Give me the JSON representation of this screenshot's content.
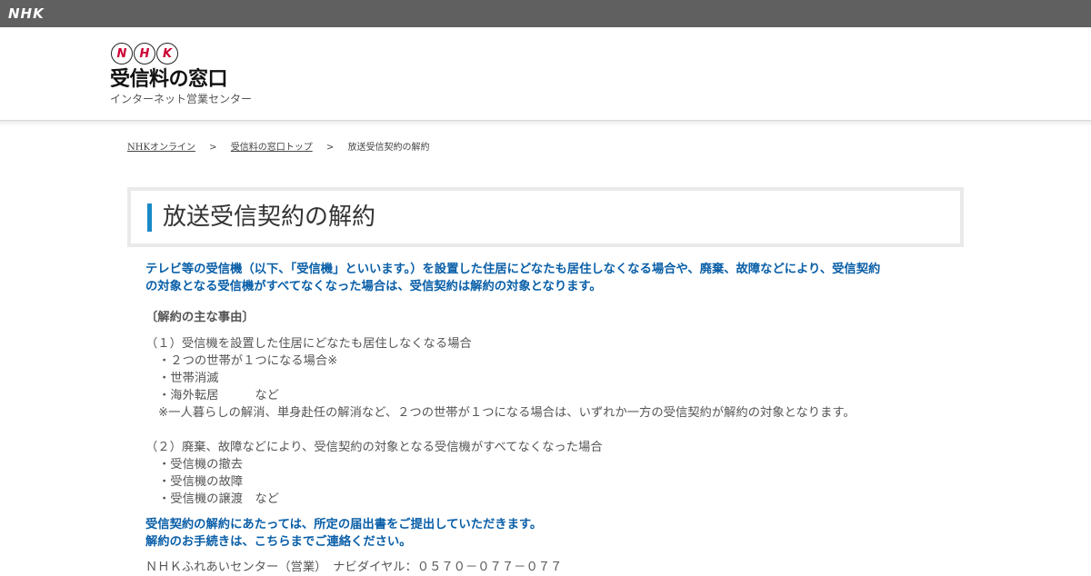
{
  "topbar": {
    "brand": "NHK"
  },
  "header": {
    "logo_letters": [
      "N",
      "H",
      "K"
    ],
    "logo_title": "受信料の窓口",
    "logo_subtitle": "インターネット営業センター"
  },
  "breadcrumb": {
    "items": [
      "NHKオンライン",
      "受信料の窓口トップ",
      "放送受信契約の解約"
    ],
    "separator": ">"
  },
  "page": {
    "title": "放送受信契約の解約",
    "intro_line1": "テレビ等の受信機（以下、「受信機」といいます。）を設置した住居にどなたも居住しなくなる場合や、廃棄、故障などにより、受信契約",
    "intro_line2": "の対象となる受信機がすべてなくなった場合は、受信契約は解約の対象となります。",
    "reasons_heading": "〔解約の主な事由〕",
    "reason1": {
      "heading": "（１）受信機を設置した住居にどなたも居住しなくなる場合",
      "items": [
        "・２つの世帯が１つになる場合※",
        "・世帯消滅",
        "・海外転居　　　など"
      ],
      "note": "※一人暮らしの解消、単身赴任の解消など、２つの世帯が１つになる場合は、いずれか一方の受信契約が解約の対象となります。"
    },
    "reason2": {
      "heading": "（２）廃棄、故障などにより、受信契約の対象となる受信機がすべてなくなった場合",
      "items": [
        "・受信機の撤去",
        "・受信機の故障",
        "・受信機の譲渡　など"
      ]
    },
    "notice_line1": "受信契約の解約にあたっては、所定の届出書をご提出していただきます。",
    "notice_line2": "解約のお手続きは、こちらまでご連絡ください。",
    "contact_line": "ＮＨＫふれあいセンター（営業）　ナビダイヤル：０５７０－０７７－０７７"
  },
  "colors": {
    "accent_blue": "#0a5fa8",
    "title_bar": "#1a8ac7",
    "topbar": "#606060"
  }
}
